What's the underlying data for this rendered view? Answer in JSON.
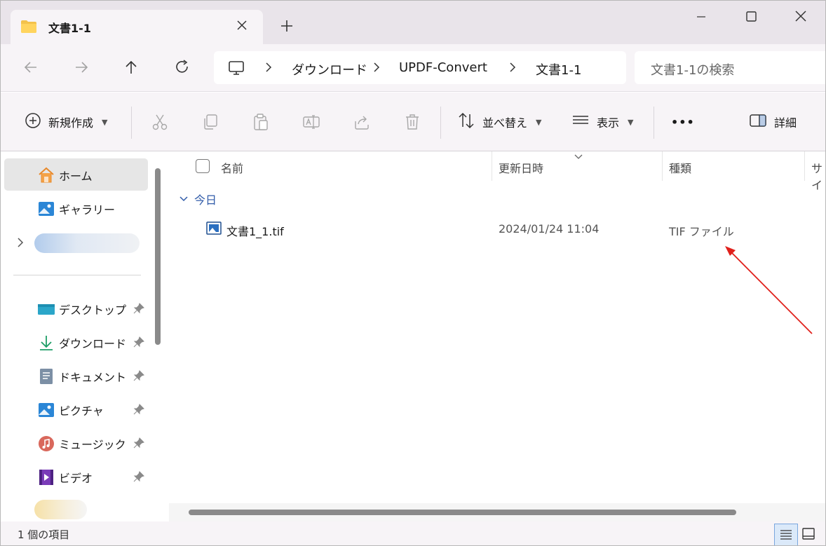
{
  "tab": {
    "title": "文書1-1"
  },
  "breadcrumb": [
    "ダウンロード",
    "UPDF-Convert",
    "文書1-1"
  ],
  "search": {
    "placeholder": "文書1-1の検索"
  },
  "toolbar": {
    "new_label": "新規作成",
    "sort_label": "並べ替え",
    "view_label": "表示",
    "more_label": "•••",
    "details_label": "詳細"
  },
  "sidebar": {
    "home": "ホーム",
    "gallery": "ギャラリー",
    "desktop": "デスクトップ",
    "downloads": "ダウンロード",
    "documents": "ドキュメント",
    "pictures": "ピクチャ",
    "music": "ミュージック",
    "videos": "ビデオ"
  },
  "columns": {
    "name": "名前",
    "date": "更新日時",
    "type": "種類",
    "size": "サイ"
  },
  "group": {
    "label": "今日"
  },
  "files": [
    {
      "name": "文書1_1.tif",
      "date": "2024/01/24 11:04",
      "type": "TIF ファイル"
    }
  ],
  "status": {
    "count": "1 個の項目"
  },
  "colors": {
    "accent": "#2f5aa8",
    "annotation_arrow": "#e0201b"
  }
}
